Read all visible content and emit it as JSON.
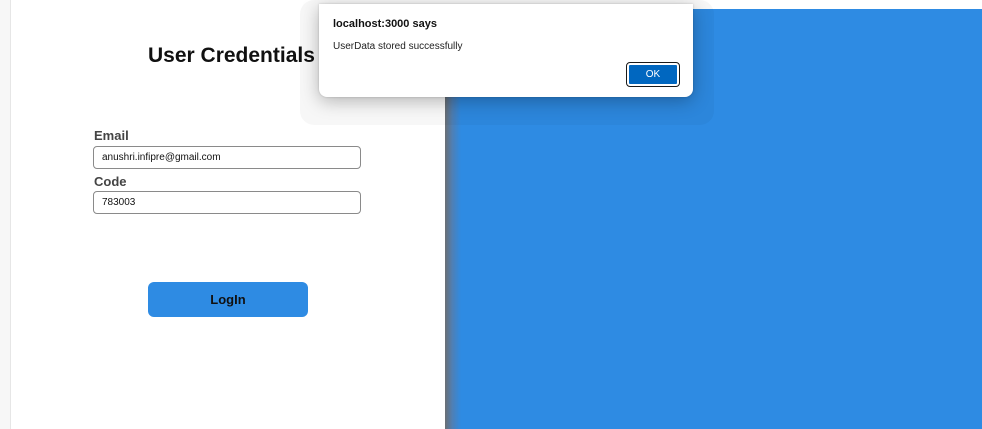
{
  "form": {
    "title": "User Credentials",
    "email_label": "Email",
    "email_value": "anushri.infipre@gmail.com",
    "code_label": "Code",
    "code_value": "783003",
    "login_label": "LogIn"
  },
  "dialog": {
    "title": "localhost:3000 says",
    "message": "UserData stored successfully",
    "ok_label": "OK"
  },
  "colors": {
    "accent": "#2e8be3",
    "dialog_button": "#0067c0"
  }
}
